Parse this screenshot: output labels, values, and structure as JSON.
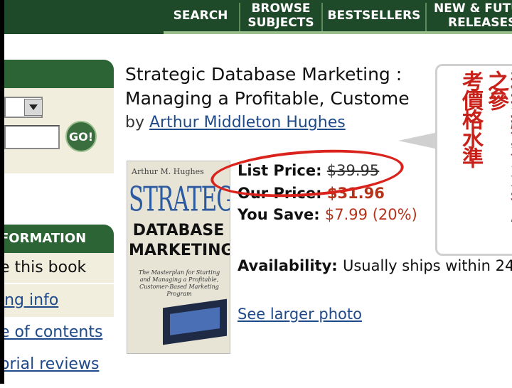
{
  "nav": {
    "items": [
      {
        "line1": "SEARCH",
        "line2": ""
      },
      {
        "line1": "BROWSE",
        "line2": "SUBJECTS"
      },
      {
        "line1": "BESTSELLERS",
        "line2": ""
      },
      {
        "line1": "NEW & FUTU",
        "line2": "RELEASES"
      }
    ]
  },
  "search": {
    "go_label": "GO!"
  },
  "info": {
    "header": "FORMATION",
    "rows": [
      "e this book",
      "ing info",
      "e of contents",
      "orial reviews"
    ]
  },
  "book": {
    "title_line1": "Strategic Database Marketing : ",
    "title_line2": "Managing a Profitable, Custome",
    "by_label": "by ",
    "author": "Arthur Middleton Hughes",
    "cover_author": "Arthur M. Hughes",
    "cover_title1": "STRATEGIC",
    "cover_title2": "DATABASE\nMARKETING",
    "cover_subtitle": "The Masterplan for Starting and Managing a Profitable, Customer-Based Marketing Program"
  },
  "pricing": {
    "list_label": "List Price: ",
    "list_value": "$39.95",
    "our_label": "Our Price: ",
    "our_value": "$31.96",
    "save_label": "You Save: ",
    "save_value": "$7.99 (20%)"
  },
  "availability": {
    "label": "Availability: ",
    "value": "Usually ships within 24"
  },
  "larger_photo": "See larger photo",
  "callout": {
    "col1": "精打細算消費者心中之參",
    "col2": "考價格水準"
  },
  "colors": {
    "nav_bg": "#1f4a2a",
    "price_red": "#b5331a",
    "link_blue": "#1f4a8a",
    "annotation_red": "#d9231c"
  }
}
